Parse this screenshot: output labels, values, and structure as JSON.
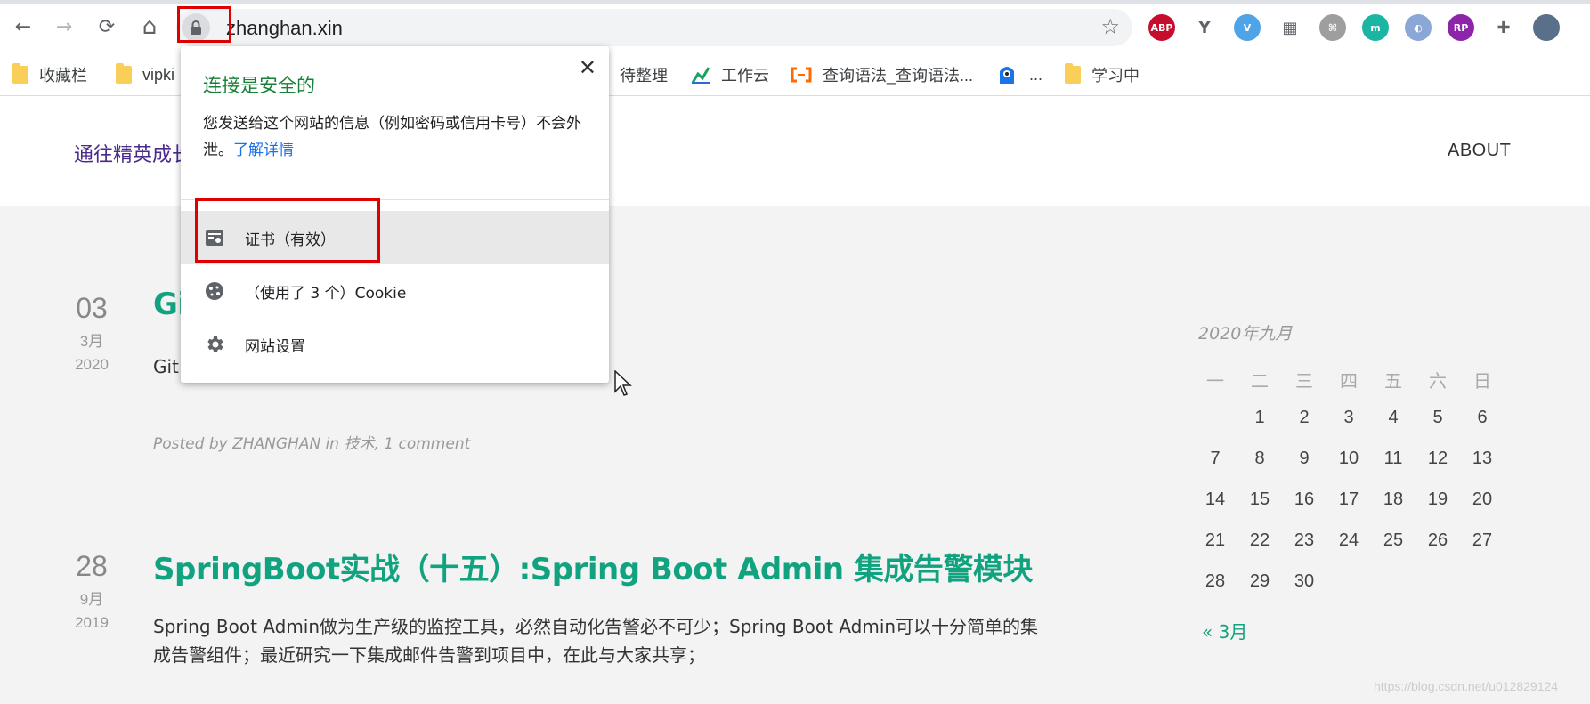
{
  "browser": {
    "url": "zhanghan.xin",
    "nav": {
      "back": "←",
      "forward": "→",
      "reload": "⟳",
      "home": "⌂"
    },
    "extensions": [
      {
        "name": "adblock-plus-icon",
        "label": "ABP",
        "color": "#c70d2c"
      },
      {
        "name": "yoroi-extension-icon",
        "label": "Y",
        "color": "#ffffff"
      },
      {
        "name": "vimeo-extension-icon",
        "label": "V",
        "color": "#4ea4e6"
      },
      {
        "name": "qr-code-icon",
        "label": "▦",
        "color": "#ffffff"
      },
      {
        "name": "command-extension-icon",
        "label": "⌘",
        "color": "#9e9e9e"
      },
      {
        "name": "m-extension-icon",
        "label": "m",
        "color": "#1cb5a3"
      },
      {
        "name": "round-extension-icon",
        "label": "◐",
        "color": "#8aa7d8"
      },
      {
        "name": "rp-extension-icon",
        "label": "RP",
        "color": "#8e24aa"
      },
      {
        "name": "extensions-puzzle-icon",
        "label": "✚",
        "color": "#ffffff"
      },
      {
        "name": "profile-avatar-icon",
        "label": "",
        "color": "#5a6f8a"
      }
    ]
  },
  "bookmarks": [
    {
      "label": "收藏栏",
      "type": "folder"
    },
    {
      "label": "vipki",
      "type": "folder"
    },
    {
      "label": "待整理",
      "type": "folder"
    },
    {
      "label": "工作云",
      "type": "site"
    },
    {
      "label": "查询语法_查询语法...",
      "type": "site"
    },
    {
      "label": "...",
      "type": "site"
    },
    {
      "label": "学习中",
      "type": "folder"
    }
  ],
  "site": {
    "title": "通往精英成长",
    "nav_about": "ABOUT"
  },
  "posts": [
    {
      "day": "03",
      "month": "3月",
      "year": "2020",
      "title": "Gi",
      "excerpt": "Git",
      "meta": "Posted by ZHANGHAN in 技术, 1 comment"
    },
    {
      "day": "28",
      "month": "9月",
      "year": "2019",
      "title": "SpringBoot实战（十五）:Spring Boot Admin 集成告警模块",
      "excerpt_line1": " Spring Boot Admin做为生产级的监控工具，必然自动化告警必不可少；Spring Boot Admin可以十分简单的集",
      "excerpt_line2": "成告警组件；最近研究一下集成邮件告警到项目中，在此与大家共享；"
    }
  ],
  "calendar": {
    "caption": "2020年九月",
    "weekdays": [
      "一",
      "二",
      "三",
      "四",
      "五",
      "六",
      "日"
    ],
    "rows": [
      [
        "",
        "1",
        "2",
        "3",
        "4",
        "5",
        "6"
      ],
      [
        "7",
        "8",
        "9",
        "10",
        "11",
        "12",
        "13"
      ],
      [
        "14",
        "15",
        "16",
        "17",
        "18",
        "19",
        "20"
      ],
      [
        "21",
        "22",
        "23",
        "24",
        "25",
        "26",
        "27"
      ],
      [
        "28",
        "29",
        "30",
        "",
        "",
        "",
        ""
      ]
    ],
    "prev_link": "« 3月"
  },
  "popup": {
    "title": "连接是安全的",
    "desc": "您发送给这个网站的信息（例如密码或信用卡号）不会外泄。",
    "learn_more": "了解详情",
    "close": "✕",
    "items": [
      {
        "label": "证书（有效）",
        "icon": "certificate-icon"
      },
      {
        "label": "（使用了 3 个）Cookie",
        "icon": "cookie-icon"
      },
      {
        "label": "网站设置",
        "icon": "gear-icon"
      }
    ]
  },
  "watermark": "https://blog.csdn.net/u012829124"
}
